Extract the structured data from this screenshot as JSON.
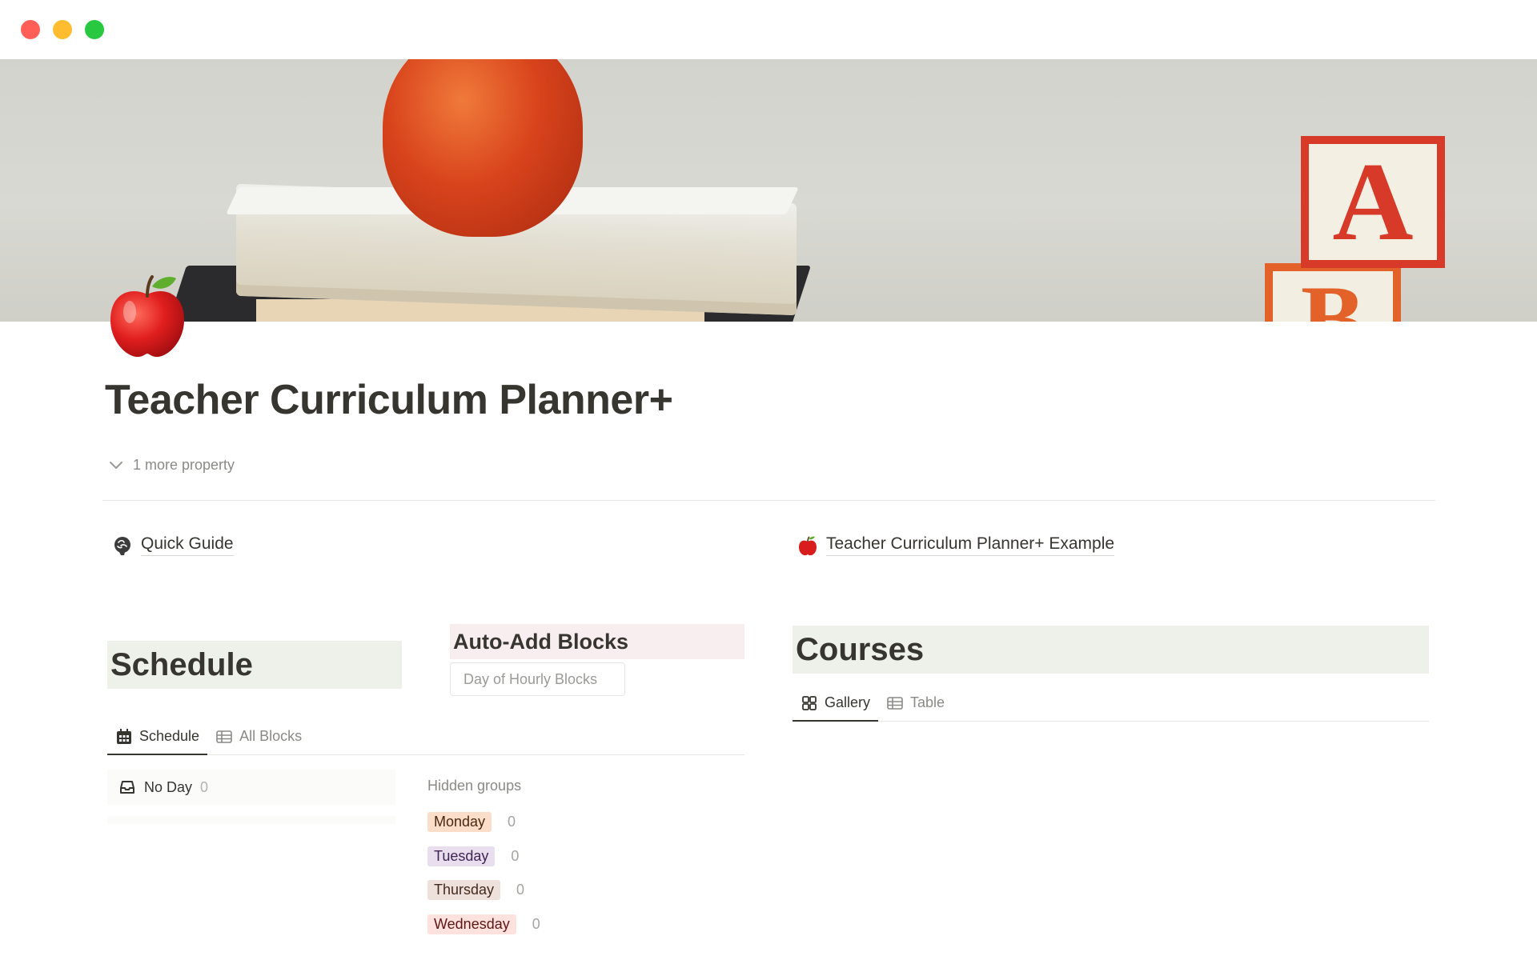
{
  "window": {
    "buttons": [
      "close",
      "minimize",
      "maximize"
    ]
  },
  "page": {
    "icon": "red-apple-icon",
    "title": "Teacher Curriculum Planner+",
    "more_property": "1 more property"
  },
  "links": {
    "quick_guide": {
      "icon": "brain-icon",
      "label": "Quick Guide"
    },
    "example": {
      "icon": "red-apple-icon",
      "label": "Teacher Curriculum Planner+ Example"
    }
  },
  "schedule": {
    "heading": "Schedule",
    "auto_add_heading": "Auto-Add Blocks",
    "auto_add_button": "Day of Hourly Blocks",
    "tabs": [
      {
        "label": "Schedule",
        "icon": "calendar-icon",
        "active": true
      },
      {
        "label": "All Blocks",
        "icon": "table-icon",
        "active": false
      }
    ],
    "no_day": {
      "label": "No Day",
      "count": "0",
      "icon": "inbox-icon"
    },
    "hidden_groups_label": "Hidden groups",
    "hidden_groups": [
      {
        "label": "Monday",
        "count": "0",
        "bg": "#fadec9",
        "fg": "#49290e"
      },
      {
        "label": "Tuesday",
        "count": "0",
        "bg": "#e8deee",
        "fg": "#412454"
      },
      {
        "label": "Thursday",
        "count": "0",
        "bg": "#eee0da",
        "fg": "#442a1e"
      },
      {
        "label": "Wednesday",
        "count": "0",
        "bg": "#ffe2dd",
        "fg": "#5d1715"
      }
    ]
  },
  "courses": {
    "heading": "Courses",
    "tabs": [
      {
        "label": "Gallery",
        "icon": "gallery-icon",
        "active": true
      },
      {
        "label": "Table",
        "icon": "table-icon",
        "active": false
      }
    ]
  },
  "colors": {
    "heading_bg": "#eef1ea",
    "pink_bg": "#f8eeef",
    "text": "#37352f",
    "muted": "#8b8a86"
  }
}
